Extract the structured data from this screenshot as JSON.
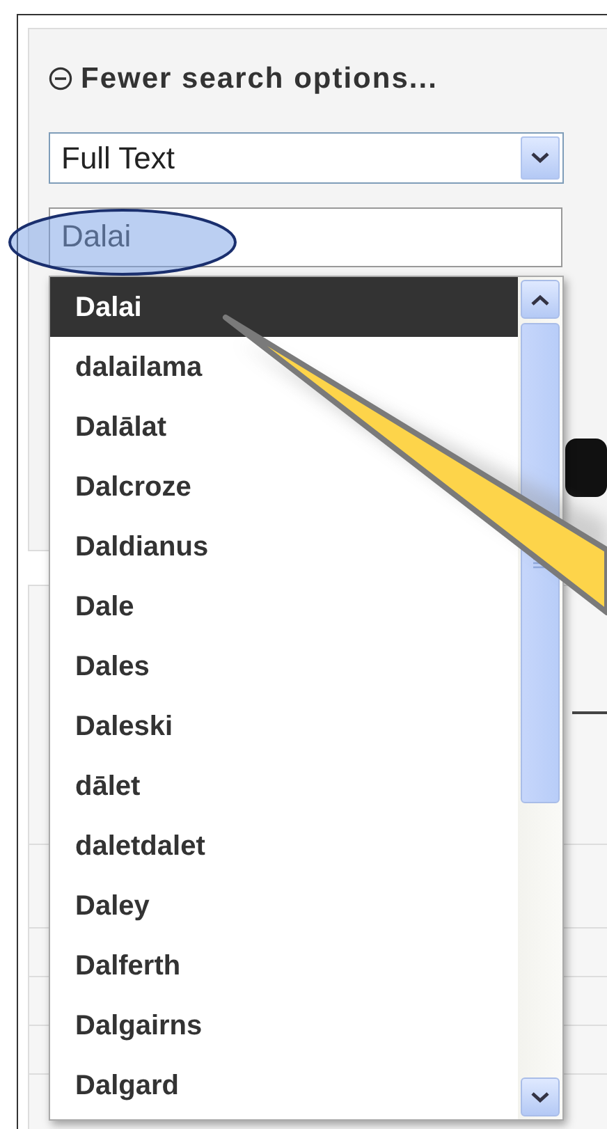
{
  "search_panel": {
    "toggle_label": "Fewer search options...",
    "field_type": "Full Text",
    "query": "Dalai"
  },
  "suggestions": [
    {
      "label": "Dalai",
      "selected": true
    },
    {
      "label": "dalailama",
      "selected": false
    },
    {
      "label": "Dalālat",
      "selected": false
    },
    {
      "label": "Dalcroze",
      "selected": false
    },
    {
      "label": "Daldianus",
      "selected": false
    },
    {
      "label": "Dale",
      "selected": false
    },
    {
      "label": "Dales",
      "selected": false
    },
    {
      "label": "Daleski",
      "selected": false
    },
    {
      "label": "dālet",
      "selected": false
    },
    {
      "label": "daletdalet",
      "selected": false
    },
    {
      "label": "Daley",
      "selected": false
    },
    {
      "label": "Dalferth",
      "selected": false
    },
    {
      "label": "Dalgairns",
      "selected": false
    },
    {
      "label": "Dalgard",
      "selected": false
    }
  ]
}
